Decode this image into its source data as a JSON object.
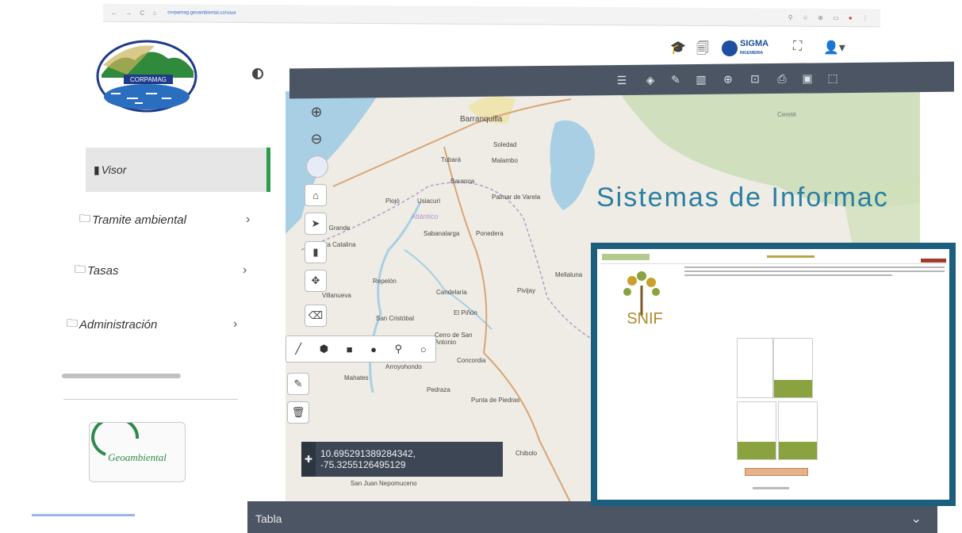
{
  "browser": {
    "url": "corpamag.geoambiental.co/visor"
  },
  "sidebar": {
    "logo_text": "CORPAMAG",
    "items": [
      {
        "label": "Visor",
        "icon": "map-icon",
        "active": true,
        "has_arrow": false
      },
      {
        "label": "Tramite ambiental",
        "icon": "folder-icon",
        "has_arrow": true
      },
      {
        "label": "Tasas",
        "icon": "folder-icon",
        "has_arrow": true
      },
      {
        "label": "Administración",
        "icon": "folder-icon",
        "has_arrow": true
      }
    ],
    "footer_logo_text": "Geoambiental"
  },
  "topbar": {
    "sigma_text": "SIGMA",
    "sigma_sub": "INGENIERIA"
  },
  "map": {
    "labels": [
      "Barranquilla",
      "Soledad",
      "Malambo",
      "Tubará",
      "Baranoa",
      "Piojó",
      "Usiacurí",
      "Palmar de Varela",
      "Atlántico",
      "Sabanalarga",
      "Ponedera",
      "Candelaria",
      "Repelón",
      "Villanueva",
      "San Cristóbal",
      "El Piñón",
      "Pivijay",
      "Cerro de San Antonio",
      "Concordia",
      "Pedraza",
      "Punta de Piedras",
      "Mahates",
      "Arroyohondo",
      "Chibolo",
      "San Juan Nepomuceno",
      "Santa Catalina",
      "Cereté",
      "Mellaluna",
      "Río Grande"
    ],
    "coordinates": "10.695291389284342, -75.3255126495129"
  },
  "bottom": {
    "label": "Tabla"
  },
  "headline": "Sistemas de Informac",
  "inset": {
    "logo_text": "SNIF"
  },
  "colors": {
    "accent_blue": "#1c5e7d",
    "toolbar_gray": "#4b5563",
    "active_green": "#2e9b4d",
    "headline": "#2a7fa4",
    "snif_green": "#8aa240"
  }
}
